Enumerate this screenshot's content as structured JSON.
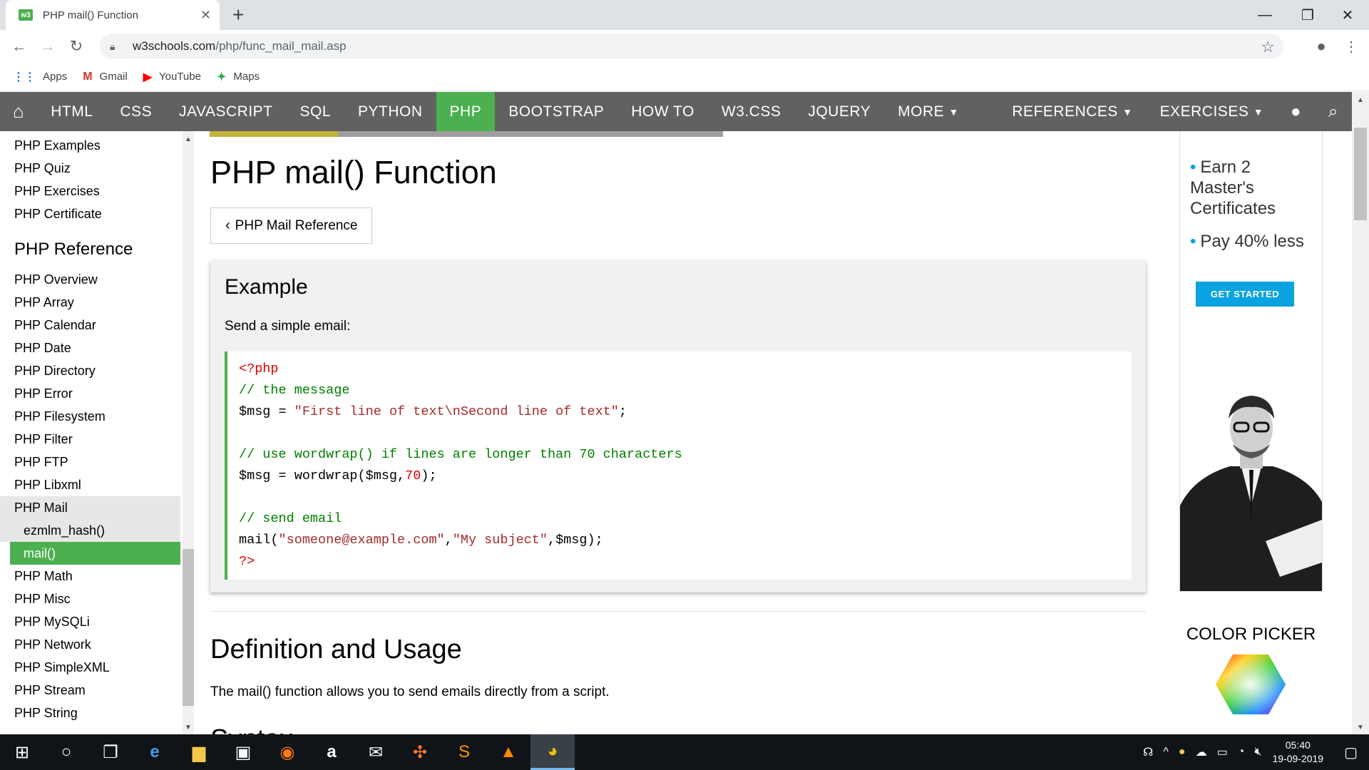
{
  "browser": {
    "tab_title": "PHP mail() Function",
    "tab_favicon_text": "w3",
    "url_host": "w3schools.com",
    "url_path": "/php/func_mail_mail.asp",
    "bookmarks": [
      {
        "label": "Apps",
        "icon": "apps-grid-icon"
      },
      {
        "label": "Gmail",
        "icon": "gmail-icon"
      },
      {
        "label": "YouTube",
        "icon": "youtube-icon"
      },
      {
        "label": "Maps",
        "icon": "maps-icon"
      }
    ]
  },
  "nav": {
    "items": [
      "HTML",
      "CSS",
      "JAVASCRIPT",
      "SQL",
      "PYTHON",
      "PHP",
      "BOOTSTRAP",
      "HOW TO",
      "W3.CSS",
      "JQUERY",
      "MORE"
    ],
    "active": "PHP",
    "right": [
      "REFERENCES",
      "EXERCISES"
    ]
  },
  "sidebar": {
    "top_links": [
      "PHP Examples",
      "PHP Quiz",
      "PHP Exercises",
      "PHP Certificate"
    ],
    "reference_header": "PHP Reference",
    "ref_links": [
      "PHP Overview",
      "PHP Array",
      "PHP Calendar",
      "PHP Date",
      "PHP Directory",
      "PHP Error",
      "PHP Filesystem",
      "PHP Filter",
      "PHP FTP",
      "PHP Libxml",
      "PHP Mail",
      "ezmlm_hash()",
      "mail()",
      "PHP Math",
      "PHP Misc",
      "PHP MySQLi",
      "PHP Network",
      "PHP SimpleXML",
      "PHP Stream",
      "PHP String"
    ]
  },
  "main": {
    "title": "PHP mail() Function",
    "ref_button": "PHP Mail Reference",
    "example_heading": "Example",
    "example_desc": "Send a simple email:",
    "code": {
      "l1": "<?php",
      "l2": "// the message",
      "l3a": "$msg = ",
      "l3b": "\"First line of text\\nSecond line of text\"",
      "l3c": ";",
      "l5": "// use wordwrap() if lines are longer than 70 characters",
      "l6a": "$msg = wordwrap($msg,",
      "l6b": "70",
      "l6c": ");",
      "l8": "// send email",
      "l9a": "mail(",
      "l9b": "\"someone@example.com\"",
      "l9c": ",",
      "l9d": "\"My subject\"",
      "l9e": ",$msg);",
      "l10": "?>"
    },
    "def_heading": "Definition and Usage",
    "def_text": "The mail() function allows you to send emails directly from a script.",
    "next_heading_partial": "Syntax"
  },
  "ad": {
    "bullet1": "Earn 2 Master's Certificates",
    "bullet2": "Pay 40% less",
    "cta": "GET STARTED"
  },
  "color_picker": {
    "label": "COLOR PICKER"
  },
  "taskbar": {
    "time": "05:40",
    "date": "19-09-2019",
    "apps": [
      "windows-start-icon",
      "search-circle-icon",
      "task-view-icon",
      "edge-icon",
      "file-explorer-icon",
      "store-icon",
      "firefox-icon",
      "amazon-icon",
      "mail-icon",
      "xampp-icon",
      "sublime-icon",
      "vlc-icon",
      "chrome-icon"
    ]
  },
  "colors": {
    "w3_green": "#4caf50",
    "nav_gray": "#616161",
    "ad_blue": "#0aa2e0"
  }
}
